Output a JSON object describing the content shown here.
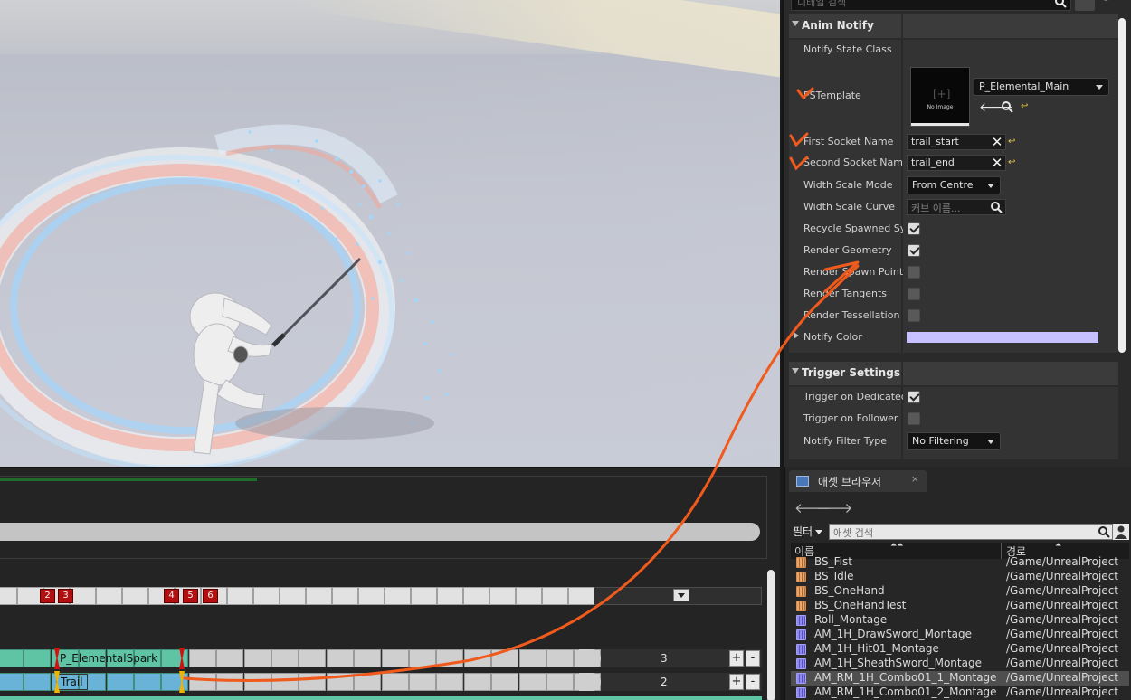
{
  "details": {
    "search_placeholder": "디테일 검색",
    "anim_notify": {
      "section_title": "Anim Notify",
      "notify_state_class_label": "Notify State Class",
      "ps_template_label": "PSTemplate",
      "thumbnail_text": "No Image",
      "ps_template_value": "P_Elemental_Main",
      "first_socket_label": "First Socket Name",
      "first_socket_value": "trail_start",
      "second_socket_label": "Second Socket Name",
      "second_socket_value": "trail_end",
      "width_scale_mode_label": "Width Scale Mode",
      "width_scale_mode_value": "From Centre",
      "width_scale_curve_label": "Width Scale Curve",
      "width_scale_curve_placeholder": "커브 이름...",
      "recycle_label": "Recycle Spawned Sys",
      "recycle_checked": true,
      "render_geometry_label": "Render Geometry",
      "render_geometry_checked": true,
      "render_spawn_points_label": "Render Spawn Points",
      "render_spawn_points_checked": false,
      "render_tangents_label": "Render Tangents",
      "render_tangents_checked": false,
      "render_tessellation_label": "Render Tessellation",
      "render_tessellation_checked": false,
      "notify_color_label": "Notify Color",
      "notify_color_value": "#c7c2ff"
    },
    "trigger_settings": {
      "section_title": "Trigger Settings",
      "dedicated_label": "Trigger on Dedicated S",
      "dedicated_checked": true,
      "follower_label": "Trigger on Follower",
      "follower_checked": false,
      "filter_type_label": "Notify Filter Type",
      "filter_type_value": "No Filtering"
    }
  },
  "timeline": {
    "markers": [
      "2",
      "3",
      "4",
      "5",
      "6"
    ],
    "tracks": [
      {
        "notify_name": "P_ElementalSpark",
        "count": "3",
        "color": "#5ec4a4"
      },
      {
        "notify_name": "Trail",
        "count": "2",
        "color": "#6ab3d8"
      }
    ],
    "plus": "+",
    "minus": "-"
  },
  "asset_browser": {
    "tab_label": "애셋 브라우저",
    "tab_close": "×",
    "back": "🡐",
    "forward": "🡒",
    "filter_label": "필터",
    "search_placeholder": "애셋 검색",
    "col_name": "이름",
    "col_path": "경로",
    "rows": [
      {
        "name": "BS_Fist",
        "path": "/Game/UnrealProject",
        "type": "blend"
      },
      {
        "name": "BS_Idle",
        "path": "/Game/UnrealProject",
        "type": "blend"
      },
      {
        "name": "BS_OneHand",
        "path": "/Game/UnrealProject",
        "type": "blend"
      },
      {
        "name": "BS_OneHandTest",
        "path": "/Game/UnrealProject",
        "type": "blend"
      },
      {
        "name": "Roll_Montage",
        "path": "/Game/UnrealProject",
        "type": "montage"
      },
      {
        "name": "AM_1H_DrawSword_Montage",
        "path": "/Game/UnrealProject",
        "type": "montage"
      },
      {
        "name": "AM_1H_Hit01_Montage",
        "path": "/Game/UnrealProject",
        "type": "montage"
      },
      {
        "name": "AM_1H_SheathSword_Montage",
        "path": "/Game/UnrealProject",
        "type": "montage"
      },
      {
        "name": "AM_RM_1H_Combo01_1_Montage",
        "path": "/Game/UnrealProject",
        "type": "montage",
        "selected": true
      },
      {
        "name": "AM_RM_1H_Combo01_2_Montage",
        "path": "/Game/UnrealProject",
        "type": "montage"
      }
    ]
  },
  "colors": {
    "annotation_orange": "#f05a1c",
    "notify_red": "#b40f0f"
  }
}
